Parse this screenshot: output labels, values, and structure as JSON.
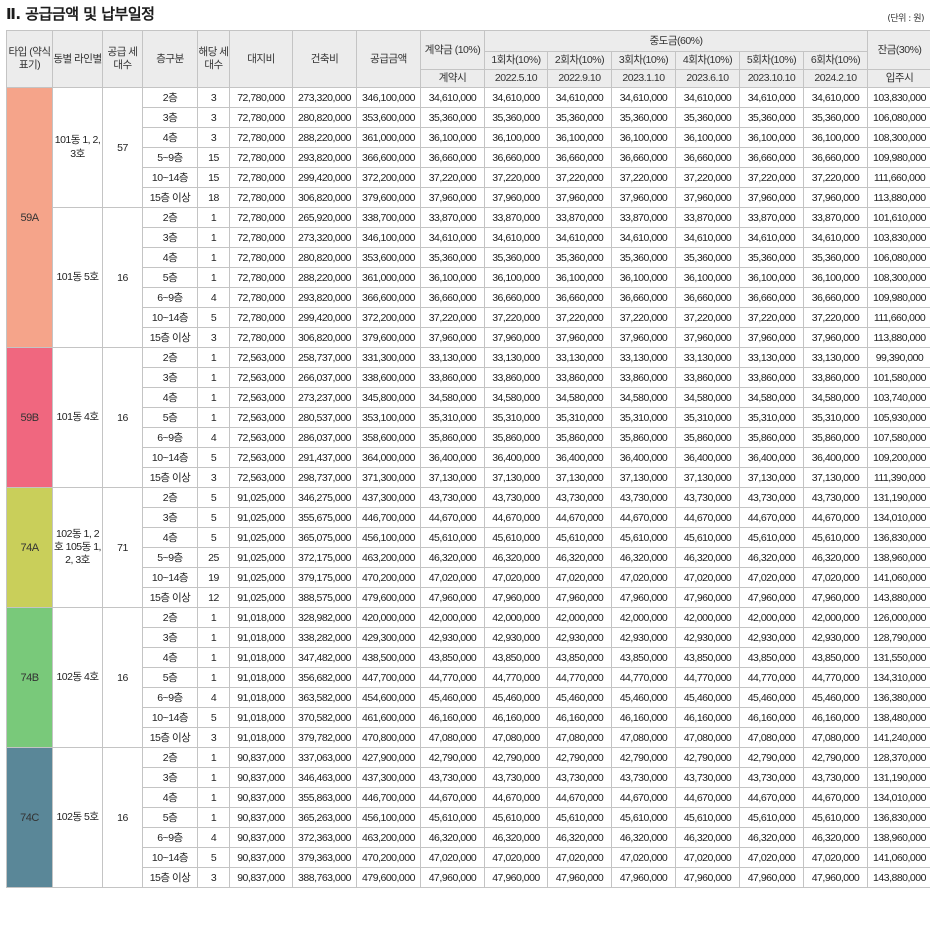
{
  "title": "Ⅱ. 공급금액 및 납부일정",
  "unit": "(단위 : 원)",
  "header": {
    "type": "타입 (약식 표기)",
    "line": "동별 라인별",
    "supply_units": "공급 세대수",
    "floor": "층구분",
    "units": "해당 세대수",
    "land": "대지비",
    "building": "건축비",
    "supply_amount": "공급금액",
    "contract": "계약금 (10%)",
    "contract_when": "계약시",
    "middle": "중도금(60%)",
    "balance": "잔금(30%)",
    "balance_when": "입주시",
    "installments": [
      "1회차(10%)",
      "2회차(10%)",
      "3회차(10%)",
      "4회차(10%)",
      "5회차(10%)",
      "6회차(10%)"
    ],
    "dates": [
      "2022.5.10",
      "2022.9.10",
      "2023.1.10",
      "2023.6.10",
      "2023.10.10",
      "2024.2.10"
    ]
  },
  "groups": [
    {
      "type": "59A",
      "color": "#f5a48a",
      "lines": [
        {
          "line": "101동 1, 2, 3호",
          "supply": "57",
          "rows": [
            [
              "2층",
              "3",
              "72,780,000",
              "273,320,000",
              "346,100,000",
              "34,610,000",
              "103,830,000"
            ],
            [
              "3층",
              "3",
              "72,780,000",
              "280,820,000",
              "353,600,000",
              "35,360,000",
              "106,080,000"
            ],
            [
              "4층",
              "3",
              "72,780,000",
              "288,220,000",
              "361,000,000",
              "36,100,000",
              "108,300,000"
            ],
            [
              "5~9층",
              "15",
              "72,780,000",
              "293,820,000",
              "366,600,000",
              "36,660,000",
              "109,980,000"
            ],
            [
              "10~14층",
              "15",
              "72,780,000",
              "299,420,000",
              "372,200,000",
              "37,220,000",
              "111,660,000"
            ],
            [
              "15층 이상",
              "18",
              "72,780,000",
              "306,820,000",
              "379,600,000",
              "37,960,000",
              "113,880,000"
            ]
          ]
        },
        {
          "line": "101동 5호",
          "supply": "16",
          "rows": [
            [
              "2층",
              "1",
              "72,780,000",
              "265,920,000",
              "338,700,000",
              "33,870,000",
              "101,610,000"
            ],
            [
              "3층",
              "1",
              "72,780,000",
              "273,320,000",
              "346,100,000",
              "34,610,000",
              "103,830,000"
            ],
            [
              "4층",
              "1",
              "72,780,000",
              "280,820,000",
              "353,600,000",
              "35,360,000",
              "106,080,000"
            ],
            [
              "5층",
              "1",
              "72,780,000",
              "288,220,000",
              "361,000,000",
              "36,100,000",
              "108,300,000"
            ],
            [
              "6~9층",
              "4",
              "72,780,000",
              "293,820,000",
              "366,600,000",
              "36,660,000",
              "109,980,000"
            ],
            [
              "10~14층",
              "5",
              "72,780,000",
              "299,420,000",
              "372,200,000",
              "37,220,000",
              "111,660,000"
            ],
            [
              "15층 이상",
              "3",
              "72,780,000",
              "306,820,000",
              "379,600,000",
              "37,960,000",
              "113,880,000"
            ]
          ]
        }
      ]
    },
    {
      "type": "59B",
      "color": "#f0677f",
      "lines": [
        {
          "line": "101동 4호",
          "supply": "16",
          "rows": [
            [
              "2층",
              "1",
              "72,563,000",
              "258,737,000",
              "331,300,000",
              "33,130,000",
              "99,390,000"
            ],
            [
              "3층",
              "1",
              "72,563,000",
              "266,037,000",
              "338,600,000",
              "33,860,000",
              "101,580,000"
            ],
            [
              "4층",
              "1",
              "72,563,000",
              "273,237,000",
              "345,800,000",
              "34,580,000",
              "103,740,000"
            ],
            [
              "5층",
              "1",
              "72,563,000",
              "280,537,000",
              "353,100,000",
              "35,310,000",
              "105,930,000"
            ],
            [
              "6~9층",
              "4",
              "72,563,000",
              "286,037,000",
              "358,600,000",
              "35,860,000",
              "107,580,000"
            ],
            [
              "10~14층",
              "5",
              "72,563,000",
              "291,437,000",
              "364,000,000",
              "36,400,000",
              "109,200,000"
            ],
            [
              "15층 이상",
              "3",
              "72,563,000",
              "298,737,000",
              "371,300,000",
              "37,130,000",
              "111,390,000"
            ]
          ]
        }
      ]
    },
    {
      "type": "74A",
      "color": "#c9cf5a",
      "lines": [
        {
          "line": "102동 1, 2호 105동 1, 2, 3호",
          "supply": "71",
          "rows": [
            [
              "2층",
              "5",
              "91,025,000",
              "346,275,000",
              "437,300,000",
              "43,730,000",
              "131,190,000"
            ],
            [
              "3층",
              "5",
              "91,025,000",
              "355,675,000",
              "446,700,000",
              "44,670,000",
              "134,010,000"
            ],
            [
              "4층",
              "5",
              "91,025,000",
              "365,075,000",
              "456,100,000",
              "45,610,000",
              "136,830,000"
            ],
            [
              "5~9층",
              "25",
              "91,025,000",
              "372,175,000",
              "463,200,000",
              "46,320,000",
              "138,960,000"
            ],
            [
              "10~14층",
              "19",
              "91,025,000",
              "379,175,000",
              "470,200,000",
              "47,020,000",
              "141,060,000"
            ],
            [
              "15층 이상",
              "12",
              "91,025,000",
              "388,575,000",
              "479,600,000",
              "47,960,000",
              "143,880,000"
            ]
          ]
        }
      ]
    },
    {
      "type": "74B",
      "color": "#79c97a",
      "lines": [
        {
          "line": "102동 4호",
          "supply": "16",
          "rows": [
            [
              "2층",
              "1",
              "91,018,000",
              "328,982,000",
              "420,000,000",
              "42,000,000",
              "126,000,000"
            ],
            [
              "3층",
              "1",
              "91,018,000",
              "338,282,000",
              "429,300,000",
              "42,930,000",
              "128,790,000"
            ],
            [
              "4층",
              "1",
              "91,018,000",
              "347,482,000",
              "438,500,000",
              "43,850,000",
              "131,550,000"
            ],
            [
              "5층",
              "1",
              "91,018,000",
              "356,682,000",
              "447,700,000",
              "44,770,000",
              "134,310,000"
            ],
            [
              "6~9층",
              "4",
              "91,018,000",
              "363,582,000",
              "454,600,000",
              "45,460,000",
              "136,380,000"
            ],
            [
              "10~14층",
              "5",
              "91,018,000",
              "370,582,000",
              "461,600,000",
              "46,160,000",
              "138,480,000"
            ],
            [
              "15층 이상",
              "3",
              "91,018,000",
              "379,782,000",
              "470,800,000",
              "47,080,000",
              "141,240,000"
            ]
          ]
        }
      ]
    },
    {
      "type": "74C",
      "color": "#5a8798",
      "lines": [
        {
          "line": "102동 5호",
          "supply": "16",
          "rows": [
            [
              "2층",
              "1",
              "90,837,000",
              "337,063,000",
              "427,900,000",
              "42,790,000",
              "128,370,000"
            ],
            [
              "3층",
              "1",
              "90,837,000",
              "346,463,000",
              "437,300,000",
              "43,730,000",
              "131,190,000"
            ],
            [
              "4층",
              "1",
              "90,837,000",
              "355,863,000",
              "446,700,000",
              "44,670,000",
              "134,010,000"
            ],
            [
              "5층",
              "1",
              "90,837,000",
              "365,263,000",
              "456,100,000",
              "45,610,000",
              "136,830,000"
            ],
            [
              "6~9층",
              "4",
              "90,837,000",
              "372,363,000",
              "463,200,000",
              "46,320,000",
              "138,960,000"
            ],
            [
              "10~14층",
              "5",
              "90,837,000",
              "379,363,000",
              "470,200,000",
              "47,020,000",
              "141,060,000"
            ],
            [
              "15층 이상",
              "3",
              "90,837,000",
              "388,763,000",
              "479,600,000",
              "47,960,000",
              "143,880,000"
            ]
          ]
        }
      ]
    }
  ]
}
